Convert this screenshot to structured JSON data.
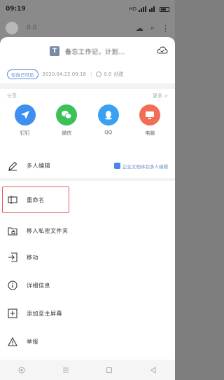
{
  "status_bar": {
    "time": "09:19",
    "network": "HD"
  },
  "background": {
    "title": "0.0"
  },
  "file": {
    "badge": "T",
    "name": "备忘工作记，计划..."
  },
  "meta": {
    "badge": "仅自己可见",
    "date": "2020.04.22 09:18",
    "size": "0.0",
    "user": "创建"
  },
  "share": {
    "heading": "分享",
    "more_label": "更多 >",
    "apps": [
      {
        "label": "钉钉",
        "color": "#3e8ff0",
        "icon": "paper-plane-icon"
      },
      {
        "label": "微信",
        "color": "#3cc159",
        "icon": "wechat-icon"
      },
      {
        "label": "QQ",
        "color": "#3aa0f2",
        "icon": "qq-icon"
      },
      {
        "label": "电脑",
        "color": "#f26d58",
        "icon": "monitor-icon"
      }
    ]
  },
  "menu": {
    "collab": "多人编辑",
    "collab_extra": "企业文档体验多人编辑",
    "rename": "重命名",
    "move_private": "移入私密文件夹",
    "move": "移动",
    "details": "详细信息",
    "add_home": "添加至主屏幕",
    "report": "举报"
  }
}
